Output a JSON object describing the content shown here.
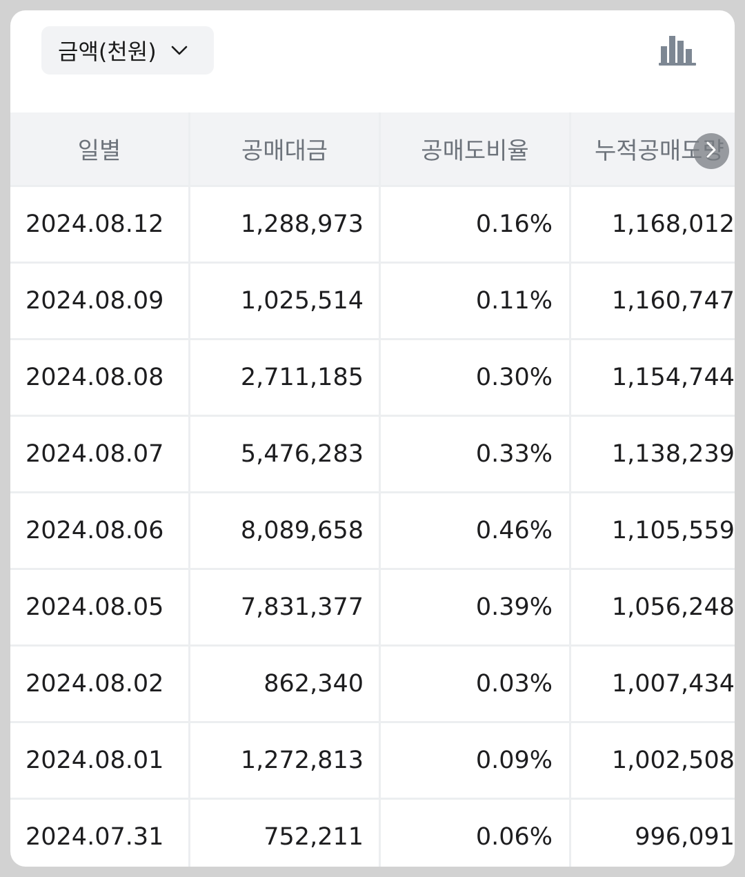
{
  "toolbar": {
    "unit_select_label": "금액(천원)",
    "unit_select_icon": "chevron-down-icon",
    "chart_toggle_icon": "bar-chart-icon"
  },
  "table": {
    "columns": [
      "일별",
      "공매대금",
      "공매도비율",
      "누적공매도량"
    ],
    "rows": [
      {
        "date": "2024.08.12",
        "amount": "1,288,973",
        "ratio": "0.16%",
        "cumulative": "1,168,012"
      },
      {
        "date": "2024.08.09",
        "amount": "1,025,514",
        "ratio": "0.11%",
        "cumulative": "1,160,747"
      },
      {
        "date": "2024.08.08",
        "amount": "2,711,185",
        "ratio": "0.30%",
        "cumulative": "1,154,744"
      },
      {
        "date": "2024.08.07",
        "amount": "5,476,283",
        "ratio": "0.33%",
        "cumulative": "1,138,239"
      },
      {
        "date": "2024.08.06",
        "amount": "8,089,658",
        "ratio": "0.46%",
        "cumulative": "1,105,559"
      },
      {
        "date": "2024.08.05",
        "amount": "7,831,377",
        "ratio": "0.39%",
        "cumulative": "1,056,248"
      },
      {
        "date": "2024.08.02",
        "amount": "862,340",
        "ratio": "0.03%",
        "cumulative": "1,007,434"
      },
      {
        "date": "2024.08.01",
        "amount": "1,272,813",
        "ratio": "0.09%",
        "cumulative": "1,002,508"
      },
      {
        "date": "2024.07.31",
        "amount": "752,211",
        "ratio": "0.06%",
        "cumulative": "996,091"
      }
    ]
  },
  "scroll_right_icon": "chevron-right-icon",
  "colors": {
    "header_bg": "#f2f3f5",
    "header_text": "#6d737b",
    "cell_text": "#1d1d1f",
    "grid_line": "#eceef0",
    "backdrop": "#d2d2d2",
    "icon_gray": "#7d8793"
  }
}
